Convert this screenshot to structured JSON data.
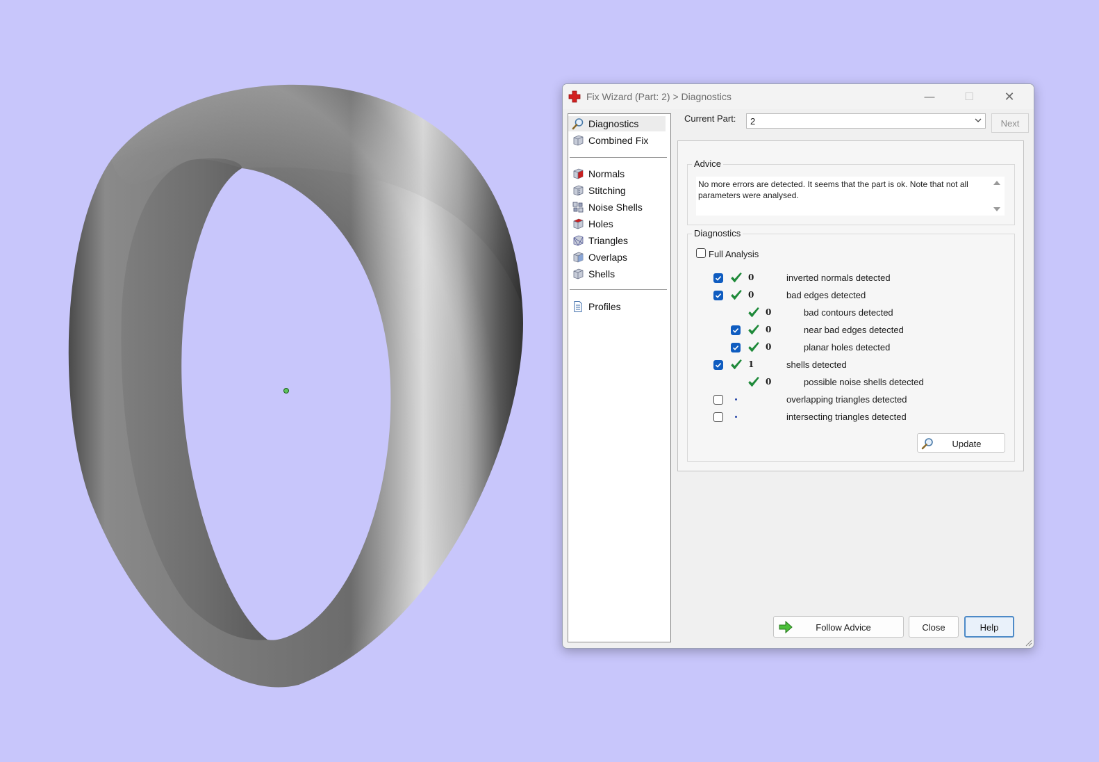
{
  "window": {
    "title": "Fix Wizard (Part: 2) > Diagnostics",
    "minimize_glyph": "—",
    "maximize_glyph": "☐",
    "close_glyph": "✕"
  },
  "nav": {
    "top": [
      {
        "label": "Diagnostics",
        "icon": "magnifier-icon",
        "selected": true
      },
      {
        "label": "Combined Fix",
        "icon": "cube-icon"
      }
    ],
    "fixes": [
      {
        "label": "Normals",
        "icon": "normals-cube-icon"
      },
      {
        "label": "Stitching",
        "icon": "stitching-cube-icon"
      },
      {
        "label": "Noise Shells",
        "icon": "noise-shells-icon"
      },
      {
        "label": "Holes",
        "icon": "holes-cube-icon"
      },
      {
        "label": "Triangles",
        "icon": "triangles-cube-icon"
      },
      {
        "label": "Overlaps",
        "icon": "overlaps-cube-icon"
      },
      {
        "label": "Shells",
        "icon": "shells-cube-icon"
      }
    ],
    "bottom": [
      {
        "label": "Profiles",
        "icon": "document-icon"
      }
    ]
  },
  "current_part": {
    "label": "Current Part:",
    "value": "2",
    "next_label": "Next"
  },
  "advice": {
    "title": "Advice",
    "text": "No more errors are detected. It seems that the part is ok. Note that not all parameters were analysed."
  },
  "diagnostics": {
    "title": "Diagnostics",
    "full_analysis_label": "Full Analysis",
    "full_analysis_checked": false,
    "rows": [
      {
        "checkbox": true,
        "checked": true,
        "status": "ok",
        "value": "0",
        "label": "inverted normals detected",
        "indent": 0
      },
      {
        "checkbox": true,
        "checked": true,
        "status": "ok",
        "value": "0",
        "label": "bad edges detected",
        "indent": 0
      },
      {
        "checkbox": false,
        "checked": false,
        "status": "ok",
        "value": "0",
        "label": "bad contours detected",
        "indent": 1
      },
      {
        "checkbox": true,
        "checked": true,
        "status": "ok",
        "value": "0",
        "label": "near bad edges detected",
        "indent": 1
      },
      {
        "checkbox": true,
        "checked": true,
        "status": "ok",
        "value": "0",
        "label": "planar holes detected",
        "indent": 1
      },
      {
        "checkbox": true,
        "checked": true,
        "status": "ok",
        "value": "1",
        "label": "shells detected",
        "indent": 0
      },
      {
        "checkbox": false,
        "checked": false,
        "status": "ok",
        "value": "0",
        "label": "possible noise shells detected",
        "indent": 1
      },
      {
        "checkbox": true,
        "checked": false,
        "status": "none",
        "value": "",
        "label": "overlapping triangles detected",
        "indent": 0
      },
      {
        "checkbox": true,
        "checked": false,
        "status": "none",
        "value": "",
        "label": "intersecting triangles detected",
        "indent": 0
      }
    ],
    "update_label": "Update"
  },
  "buttons": {
    "follow_advice": "Follow Advice",
    "close": "Close",
    "help": "Help"
  },
  "colors": {
    "viewport_background": "#c8c6fb",
    "checkbox_accent": "#0f5cc0",
    "ok_tick": "#1f8a3a"
  }
}
